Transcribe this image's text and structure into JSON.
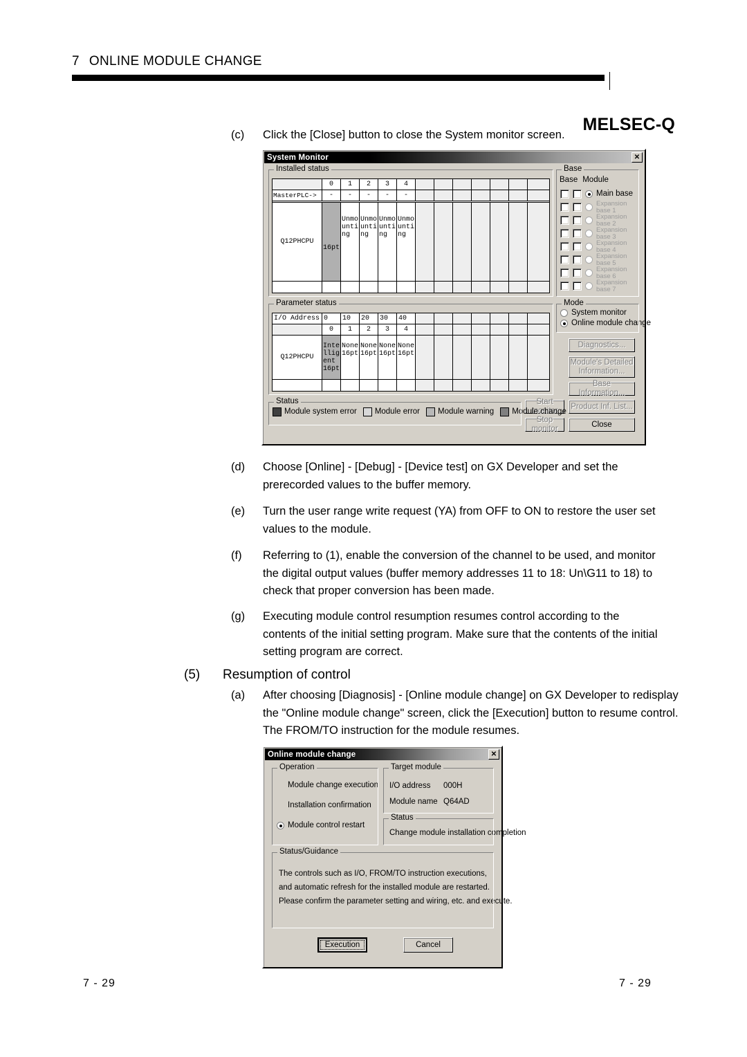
{
  "header": {
    "chapter_number": "7",
    "chapter_title": "ONLINE MODULE CHANGE",
    "brand": "MELSEC-Q"
  },
  "footer": {
    "left": "7 - 29",
    "right": "7 - 29"
  },
  "body": {
    "step_c": {
      "marker": "(c)",
      "text": "Click the [Close] button to close the System monitor screen."
    },
    "step_d": {
      "marker": "(d)",
      "text": "Choose [Online] - [Debug] - [Device test] on GX Developer and set the prerecorded values to the buffer memory."
    },
    "step_e": {
      "marker": "(e)",
      "text": "Turn the user range write request (YA) from OFF to ON to restore the user set values to the module."
    },
    "step_f": {
      "marker": "(f)",
      "text": "Referring to (1), enable the conversion of the channel to be used, and monitor the digital output values (buffer memory addresses 11 to 18: Un\\G11 to 18) to check that proper conversion has been made."
    },
    "step_g": {
      "marker": "(g)",
      "text": "Executing module control resumption resumes control according to the contents of the initial setting program. Make sure that the contents of the initial setting program are correct."
    },
    "section5": {
      "marker": "(5)",
      "title": "Resumption of control"
    },
    "step_5a": {
      "marker": "(a)",
      "text": "After choosing [Diagnosis] - [Online module change] on GX Developer to redisplay the \"Online module change\" screen, click the [Execution] button to resume control. The FROM/TO instruction for the module resumes."
    }
  },
  "system_monitor": {
    "title": "System Monitor",
    "close_icon": "close-icon",
    "installed_status": {
      "legend": "Installed status",
      "slot_headers": [
        "0",
        "1",
        "2",
        "3",
        "4",
        "",
        "",
        "",
        "",
        "",
        "",
        ""
      ],
      "master_label": "MasterPLC->",
      "master_values": [
        "-",
        "-",
        "-",
        "-",
        "-",
        "",
        "",
        "",
        "",
        "",
        "",
        ""
      ],
      "cpu_label": "Q12PHCPU",
      "module_cells": [
        "16pt",
        "Unmounting",
        "Unmounting",
        "Unmounting",
        "Unmounting",
        "",
        "",
        "",
        "",
        "",
        "",
        ""
      ],
      "highlighted_slot": 0
    },
    "base": {
      "legend": "Base",
      "col_base": "Base",
      "col_module": "Module",
      "items": [
        {
          "label": "Main base",
          "selected": true,
          "enabled": true
        },
        {
          "label": "Expansion base 1",
          "selected": false,
          "enabled": false
        },
        {
          "label": "Expansion base 2",
          "selected": false,
          "enabled": false
        },
        {
          "label": "Expansion base 3",
          "selected": false,
          "enabled": false
        },
        {
          "label": "Expansion base 4",
          "selected": false,
          "enabled": false
        },
        {
          "label": "Expansion base 5",
          "selected": false,
          "enabled": false
        },
        {
          "label": "Expansion base 6",
          "selected": false,
          "enabled": false
        },
        {
          "label": "Expansion base 7",
          "selected": false,
          "enabled": false
        }
      ]
    },
    "parameter_status": {
      "legend": "Parameter status",
      "io_address_label": "I/O Address",
      "io_addresses": [
        "0",
        "10",
        "20",
        "30",
        "40",
        "",
        "",
        "",
        "",
        "",
        "",
        ""
      ],
      "slot_headers": [
        "0",
        "1",
        "2",
        "3",
        "4",
        "",
        "",
        "",
        "",
        "",
        "",
        ""
      ],
      "cpu_label": "Q12PHCPU",
      "module_cells": [
        "Intelligent 16pt",
        "None 16pt",
        "None 16pt",
        "None 16pt",
        "None 16pt",
        "",
        "",
        "",
        "",
        "",
        "",
        ""
      ],
      "highlighted_slot": 0
    },
    "mode": {
      "legend": "Mode",
      "options": [
        {
          "label": "System monitor",
          "selected": false
        },
        {
          "label": "Online module change",
          "selected": true
        }
      ]
    },
    "buttons": {
      "diagnostics": "Diagnostics...",
      "module_detail": "Module's Detailed Information...",
      "base_information": "Base Information...",
      "product_inf_list": "Product Inf. List...",
      "close": "Close",
      "start_monitor": "Start monitor",
      "stop_monitor": "Stop monitor"
    },
    "status_legend": {
      "legend": "Status",
      "items": [
        {
          "label": "Module system error",
          "color": "#404040"
        },
        {
          "label": "Module error",
          "color": "#d8d8d8"
        },
        {
          "label": "Module warning",
          "color": "#b8b8b8"
        },
        {
          "label": "Module change",
          "color": "#808080"
        }
      ]
    }
  },
  "online_module_change": {
    "title": "Online module change",
    "close_icon": "close-icon",
    "operation": {
      "legend": "Operation",
      "items": [
        {
          "label": "Module change execution",
          "selected": false,
          "show_radio": false
        },
        {
          "label": "Installation confirmation",
          "selected": false,
          "show_radio": false
        },
        {
          "label": "Module control restart",
          "selected": true,
          "show_radio": true
        }
      ]
    },
    "target_module": {
      "legend": "Target module",
      "io_address_label": "I/O address",
      "io_address_value": "000H",
      "module_name_label": "Module name",
      "module_name_value": "Q64AD"
    },
    "status": {
      "legend": "Status",
      "text": "Change module installation completion"
    },
    "guidance": {
      "legend": "Status/Guidance",
      "line1": "The controls such as I/O, FROM/TO instruction executions,",
      "line2": "and automatic refresh for the installed module are restarted.",
      "line3": "Please confirm the parameter setting and wiring, etc. and execute."
    },
    "buttons": {
      "execution": "Execution",
      "cancel": "Cancel"
    }
  }
}
